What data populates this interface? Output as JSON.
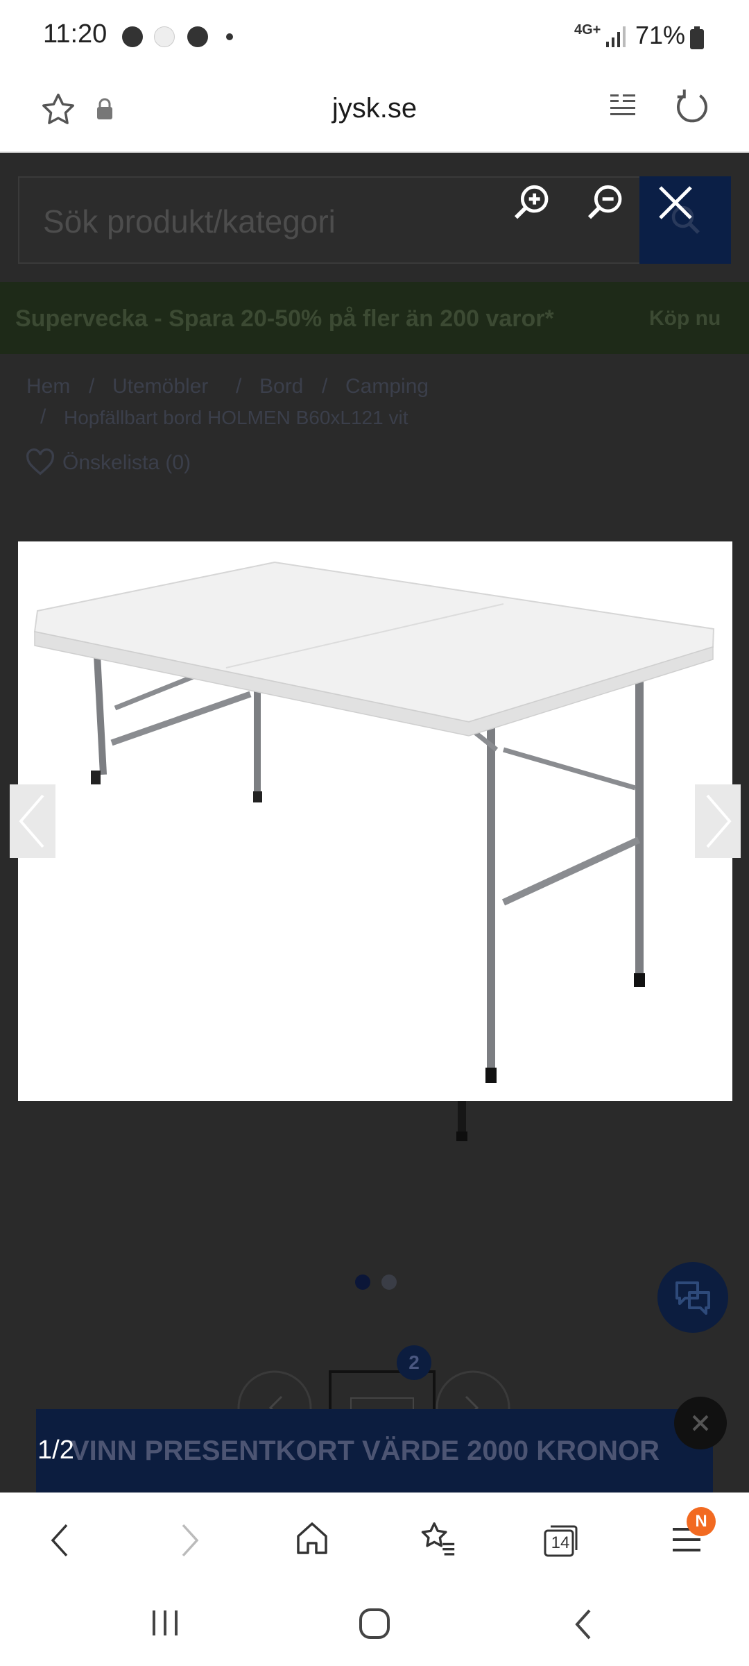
{
  "status_bar": {
    "time": "11:20",
    "network": "4G+",
    "battery": "71%"
  },
  "browser": {
    "url": "jysk.se",
    "tabs_count": "14",
    "menu_badge": "N"
  },
  "page": {
    "search_placeholder": "Sök produkt/kategori",
    "promo_text": "Supervecka - Spara 20-50% på fler än 200 varor*",
    "promo_link": "Köp nu",
    "breadcrumb": [
      "Hem",
      "Utemöbler",
      "Bord",
      "Camping"
    ],
    "breadcrumb_sep": "/",
    "product_title": "Hopfällbart bord HOLMEN B60xL121 vit",
    "wishlist": "Önskelista (0)",
    "thumbnail_count": "2",
    "contest_banner": "VINN PRESENTKORT VÄRDE 2000 KRONOR"
  },
  "viewer": {
    "counter": "1/2"
  },
  "icons": {
    "zoom_in": "zoom-in-icon",
    "zoom_out": "zoom-out-icon",
    "close": "close-icon",
    "prev": "chevron-left-icon",
    "next": "chevron-right-icon"
  },
  "colors": {
    "navy": "#0c1d3f",
    "promo_green": "#1e2a18",
    "badge_orange": "#f26a21"
  }
}
